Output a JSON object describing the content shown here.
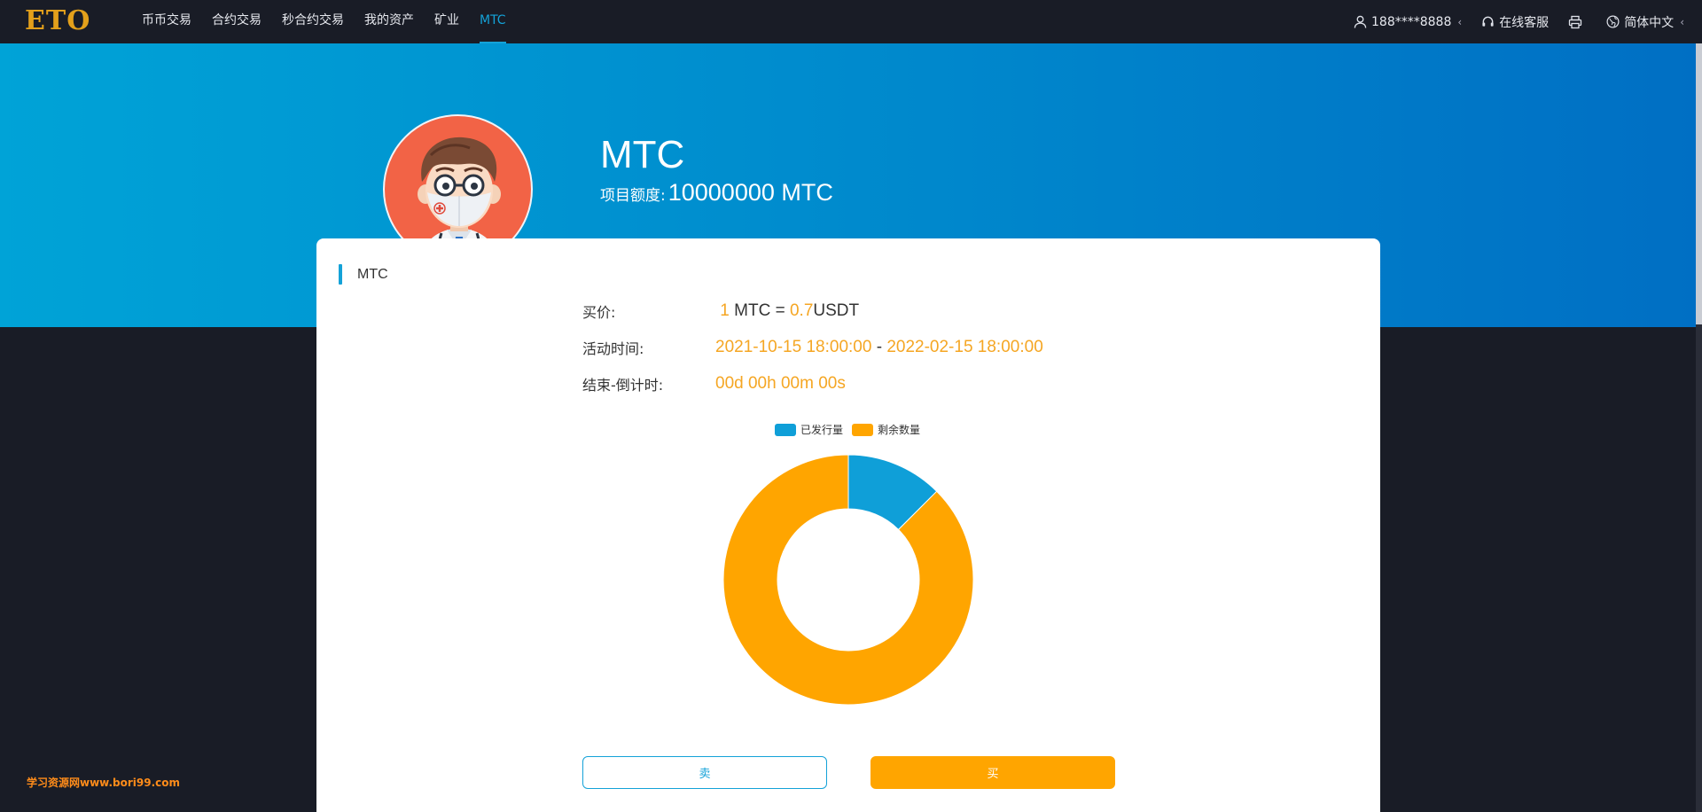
{
  "brand": {
    "logo_text": "ETO",
    "logo_color": "#e3a01b"
  },
  "nav": {
    "items": [
      {
        "label": "币币交易"
      },
      {
        "label": "合约交易"
      },
      {
        "label": "秒合约交易"
      },
      {
        "label": "我的资产"
      },
      {
        "label": "矿业"
      },
      {
        "label": "MTC",
        "active": true
      }
    ]
  },
  "header_right": {
    "user": "188****8888",
    "service": "在线客服",
    "language": "简体中文"
  },
  "project": {
    "name": "MTC",
    "quota_label": "项目额度:",
    "quota_value": "10000000 MTC"
  },
  "card": {
    "tag": "MTC",
    "price_label": "买价:",
    "price_amount": "1",
    "price_unit": "MTC",
    "price_eq": "=",
    "price_value": "0.7",
    "price_currency": "USDT",
    "time_label": "活动时间:",
    "time_start": "2021-10-15 18:00:00",
    "time_sep": "-",
    "time_end": "2022-02-15 18:00:00",
    "countdown_label": "结束-倒计时:",
    "countdown_value": "00d 00h 00m 00s",
    "sell_label": "卖",
    "buy_label": "买"
  },
  "chart_data": {
    "type": "pie",
    "donut": true,
    "categories": [
      "已发行量",
      "剩余数量"
    ],
    "values": [
      12.5,
      87.5
    ],
    "colors": [
      "#0f9fd8",
      "#ffa500"
    ],
    "legend": "top"
  },
  "colors": {
    "accent": "#14a2d8",
    "orange": "#f5a623",
    "nav_bg": "#191c26"
  },
  "watermark": "学习资源网www.bori99.com"
}
